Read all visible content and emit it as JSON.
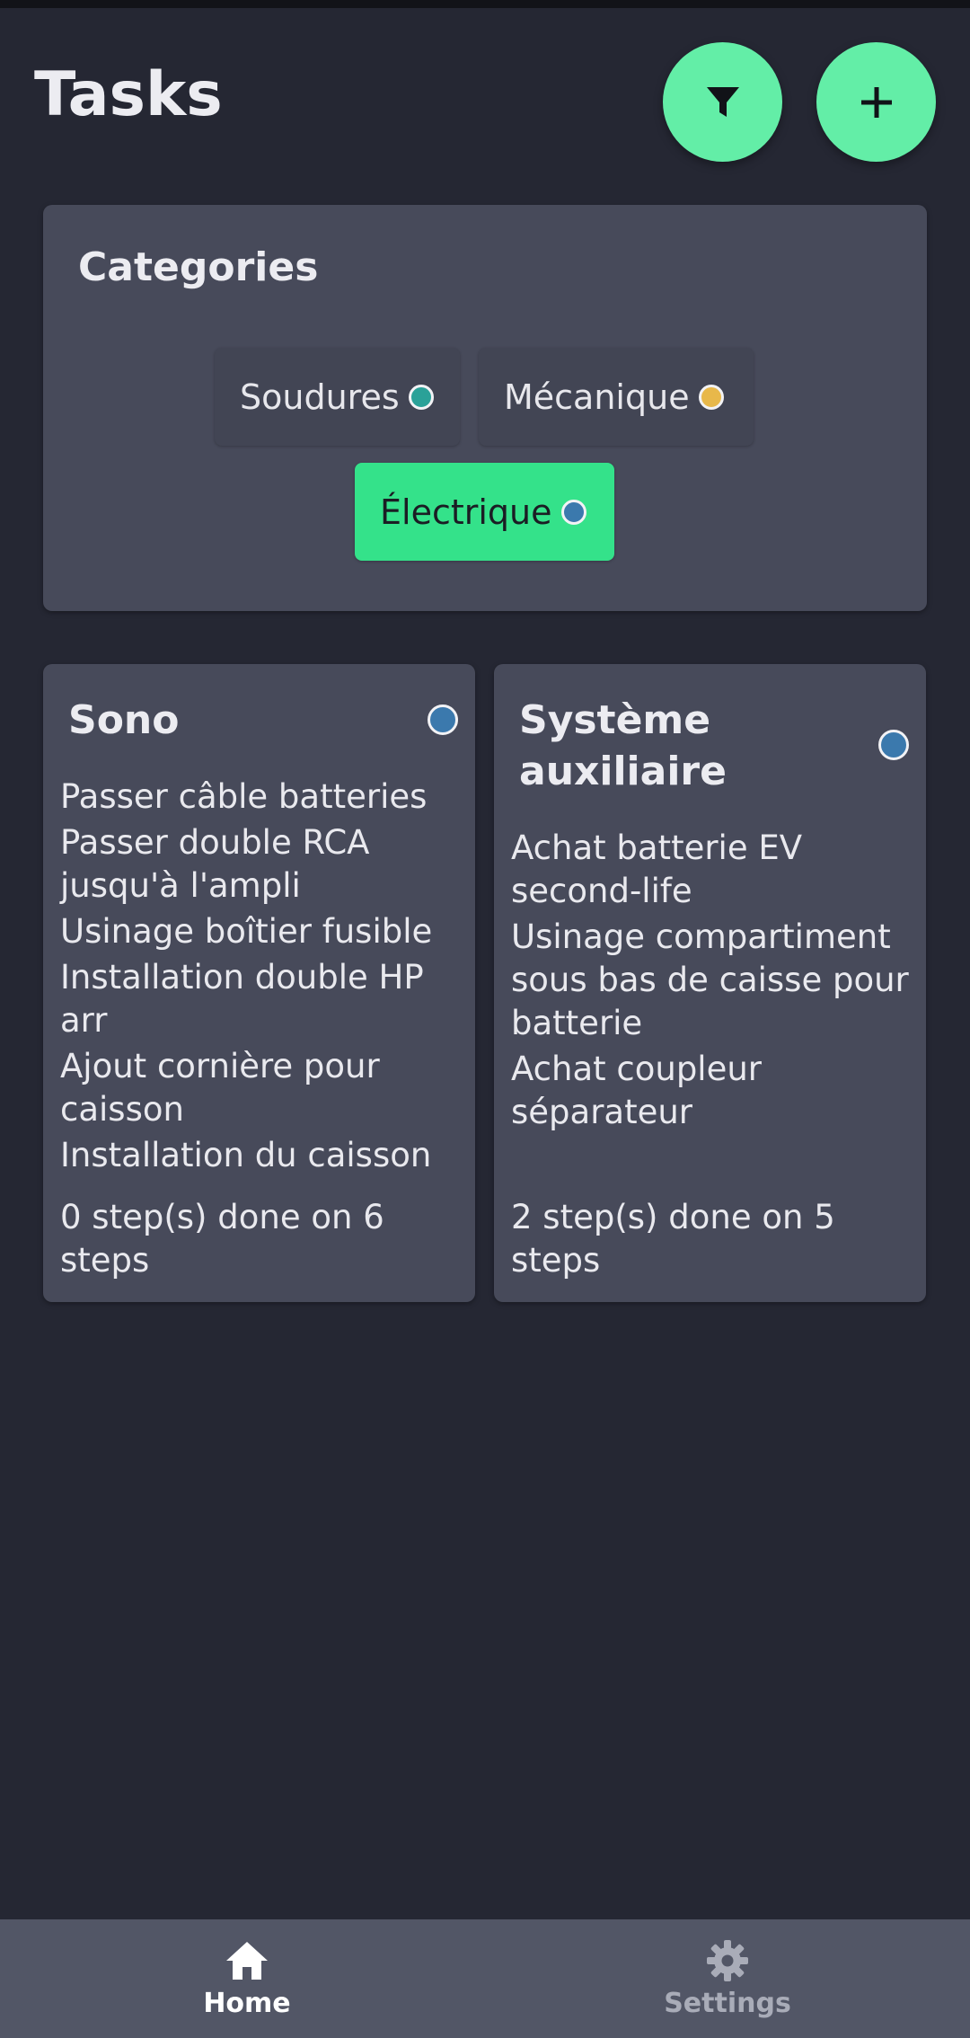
{
  "header": {
    "title": "Tasks",
    "filter_icon": "filter-icon",
    "add_icon": "plus-icon"
  },
  "categories": {
    "title": "Categories",
    "items": [
      {
        "label": "Soudures",
        "color": "#2aa198",
        "selected": false
      },
      {
        "label": "Mécanique",
        "color": "#e8b84a",
        "selected": false
      },
      {
        "label": "Électrique",
        "color": "#3b79ad",
        "selected": true
      }
    ]
  },
  "tasks": [
    {
      "title": "Sono",
      "color": "#3b79ad",
      "steps": [
        "Passer câble batteries",
        "Passer double RCA jusqu'à l'ampli",
        "Usinage boîtier fusible",
        "Installation double HP arr",
        "Ajout cornière pour caisson",
        "Installation du caisson"
      ],
      "progress": "0 step(s) done on 6 steps"
    },
    {
      "title": "Système auxiliaire",
      "color": "#3b79ad",
      "steps": [
        "Achat batterie EV second-life",
        "Usinage compartiment sous bas de caisse pour batterie",
        "Achat coupleur séparateur"
      ],
      "progress": "2 step(s) done on 5 steps"
    }
  ],
  "bottom_nav": {
    "items": [
      {
        "label": "Home",
        "icon": "home-icon",
        "active": true
      },
      {
        "label": "Settings",
        "icon": "gear-icon",
        "active": false
      }
    ]
  },
  "colors": {
    "background": "#252733",
    "card": "#474a5a",
    "accent": "#63eea7",
    "chip_active": "#34e28a",
    "nav_bar": "#525666"
  }
}
